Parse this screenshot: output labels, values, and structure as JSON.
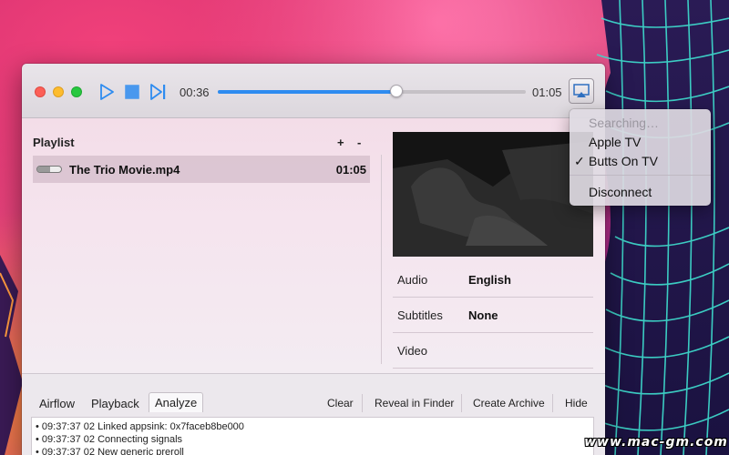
{
  "player": {
    "elapsed": "00:36",
    "total": "01:05",
    "progress": 0.58
  },
  "playlist": {
    "title": "Playlist",
    "add_label": "+",
    "remove_label": "-",
    "items": [
      {
        "name": "The Trio Movie.mp4",
        "duration": "01:05",
        "progress": 0.55
      }
    ]
  },
  "tracks": {
    "audio_label": "Audio",
    "audio_value": "English",
    "subtitles_label": "Subtitles",
    "subtitles_value": "None",
    "video_label": "Video"
  },
  "bottom": {
    "tabs": [
      "Airflow",
      "Playback",
      "Analyze"
    ],
    "active_tab": "Analyze",
    "actions": [
      "Clear",
      "Reveal in Finder",
      "Create Archive",
      "Hide"
    ],
    "log": [
      "• 09:37:37 02 Linked appsink: 0x7faceb8be000",
      "• 09:37:37 02 Connecting signals",
      "• 09:37:37 02 New generic preroll"
    ]
  },
  "airplay_menu": {
    "status": "Searching…",
    "devices": [
      "Apple TV",
      "Butts On TV"
    ],
    "selected": "Butts On TV",
    "check": "✓",
    "disconnect": "Disconnect"
  },
  "watermark": "www.mac-gm.com",
  "colors": {
    "accent": "#2e8cf0",
    "menu_bg": "#dedae2"
  },
  "icons": [
    "play-icon",
    "stop-icon",
    "skip-next-icon",
    "airplay-icon"
  ]
}
